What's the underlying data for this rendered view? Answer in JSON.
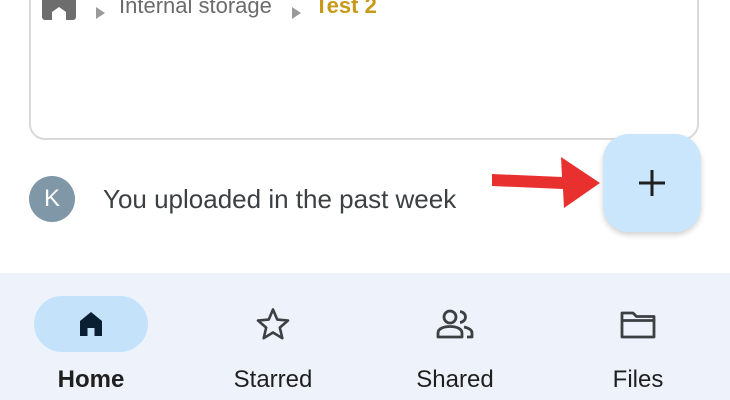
{
  "breadcrumb": {
    "home_icon": "home-icon",
    "items": [
      "Internal storage",
      "Test 2"
    ]
  },
  "activity": {
    "avatar_letter": "K",
    "text": "You uploaded in the past week"
  },
  "fab": {
    "icon": "plus-icon"
  },
  "nav": {
    "items": [
      {
        "label": "Home",
        "icon": "home-icon",
        "active": true
      },
      {
        "label": "Starred",
        "icon": "star-icon",
        "active": false
      },
      {
        "label": "Shared",
        "icon": "people-icon",
        "active": false
      },
      {
        "label": "Files",
        "icon": "folder-icon",
        "active": false
      }
    ]
  },
  "colors": {
    "accent_current_folder": "#c79a1b",
    "fab_background": "#c9e6fc",
    "nav_background": "#eef3fb",
    "nav_active_pill": "#c4e3fb",
    "annotation_arrow": "#e8302f",
    "avatar": "#7f97a6"
  }
}
